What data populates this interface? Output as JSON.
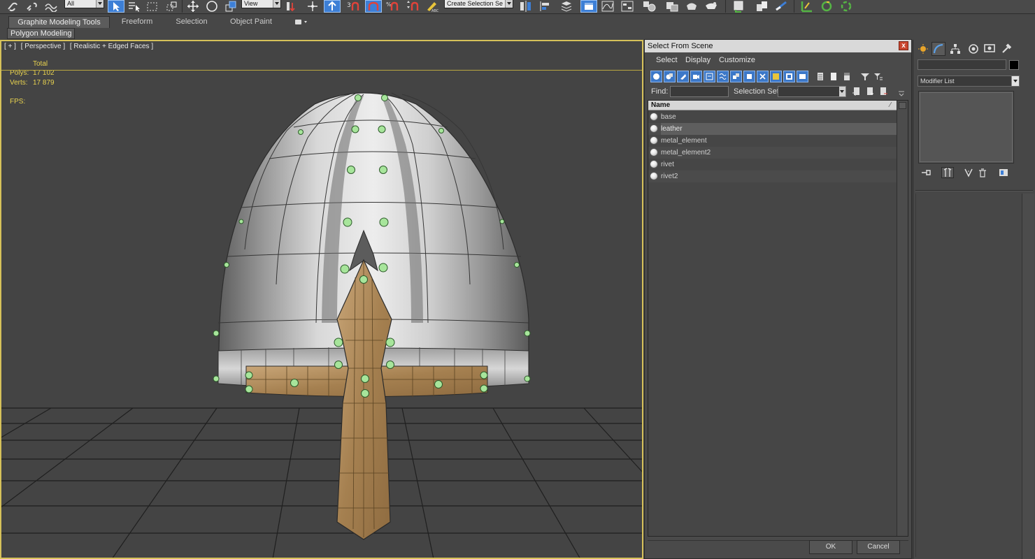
{
  "toolbar": {
    "filter_value": "All",
    "view_value": "View",
    "selection_set_value": "Create Selection Se"
  },
  "ribbon": {
    "tabs": [
      {
        "label": "Graphite Modeling Tools"
      },
      {
        "label": "Freeform"
      },
      {
        "label": "Selection"
      },
      {
        "label": "Object Paint"
      }
    ],
    "panel_label": "Polygon Modeling"
  },
  "viewport": {
    "labels": [
      "[ + ]",
      "[ Perspective ]",
      "[ Realistic + Edged Faces ]"
    ],
    "stats": {
      "total_label": "Total",
      "polys_label": "Polys:",
      "polys_value": "17 102",
      "verts_label": "Verts:",
      "verts_value": "17 879",
      "fps_label": "FPS:"
    },
    "colors": {
      "stats_text": "#e9d34f",
      "active_border": "#d6c15a",
      "grid_line": "#1f1f1f"
    }
  },
  "dialog": {
    "title": "Select From Scene",
    "close_glyph": "x",
    "menu": [
      "Select",
      "Display",
      "Customize"
    ],
    "find_label": "Find:",
    "find_value": "",
    "selection_set_label": "Selection Set:",
    "column_header": "Name",
    "sort_glyph": "∕",
    "objects": [
      {
        "name": "base"
      },
      {
        "name": "leather"
      },
      {
        "name": "metal_element"
      },
      {
        "name": "metal_element2"
      },
      {
        "name": "rivet"
      },
      {
        "name": "rivet2"
      }
    ],
    "ok_label": "OK",
    "cancel_label": "Cancel"
  },
  "command_panel": {
    "modifier_list_label": "Modifier List",
    "object_color": "#000000"
  }
}
